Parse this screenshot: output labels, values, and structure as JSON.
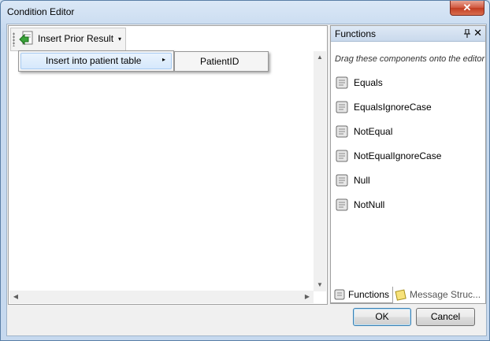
{
  "window": {
    "title": "Condition Editor",
    "close_glyph": "✕"
  },
  "toolbar": {
    "button_label": "Insert Prior Result",
    "dropdown_glyph": "▾",
    "icon": "insert-prior-result-icon"
  },
  "menu": {
    "item_label": "Insert into patient table",
    "submenu_arrow": "▸",
    "submenu_item": "PatientID"
  },
  "scrollbars": {
    "up": "▲",
    "down": "▼",
    "left": "◀",
    "right": "▶"
  },
  "functions_panel": {
    "title": "Functions",
    "pin_glyph": "📌",
    "close_glyph": "✕",
    "hint": "Drag these components onto the editor",
    "items": [
      "Equals",
      "EqualsIgnoreCase",
      "NotEqual",
      "NotEqualIgnoreCase",
      "Null",
      "NotNull"
    ],
    "item_icon": "scroll-icon"
  },
  "tabs": [
    {
      "label": "Functions",
      "icon": "scroll-icon"
    },
    {
      "label": "Message Struc...",
      "icon": "note-icon"
    }
  ],
  "buttons": {
    "ok": "OK",
    "cancel": "Cancel"
  },
  "colors": {
    "titlebar": "#c6d9ef",
    "close_button": "#c23d21",
    "menu_highlight": "#d5e8fc"
  }
}
